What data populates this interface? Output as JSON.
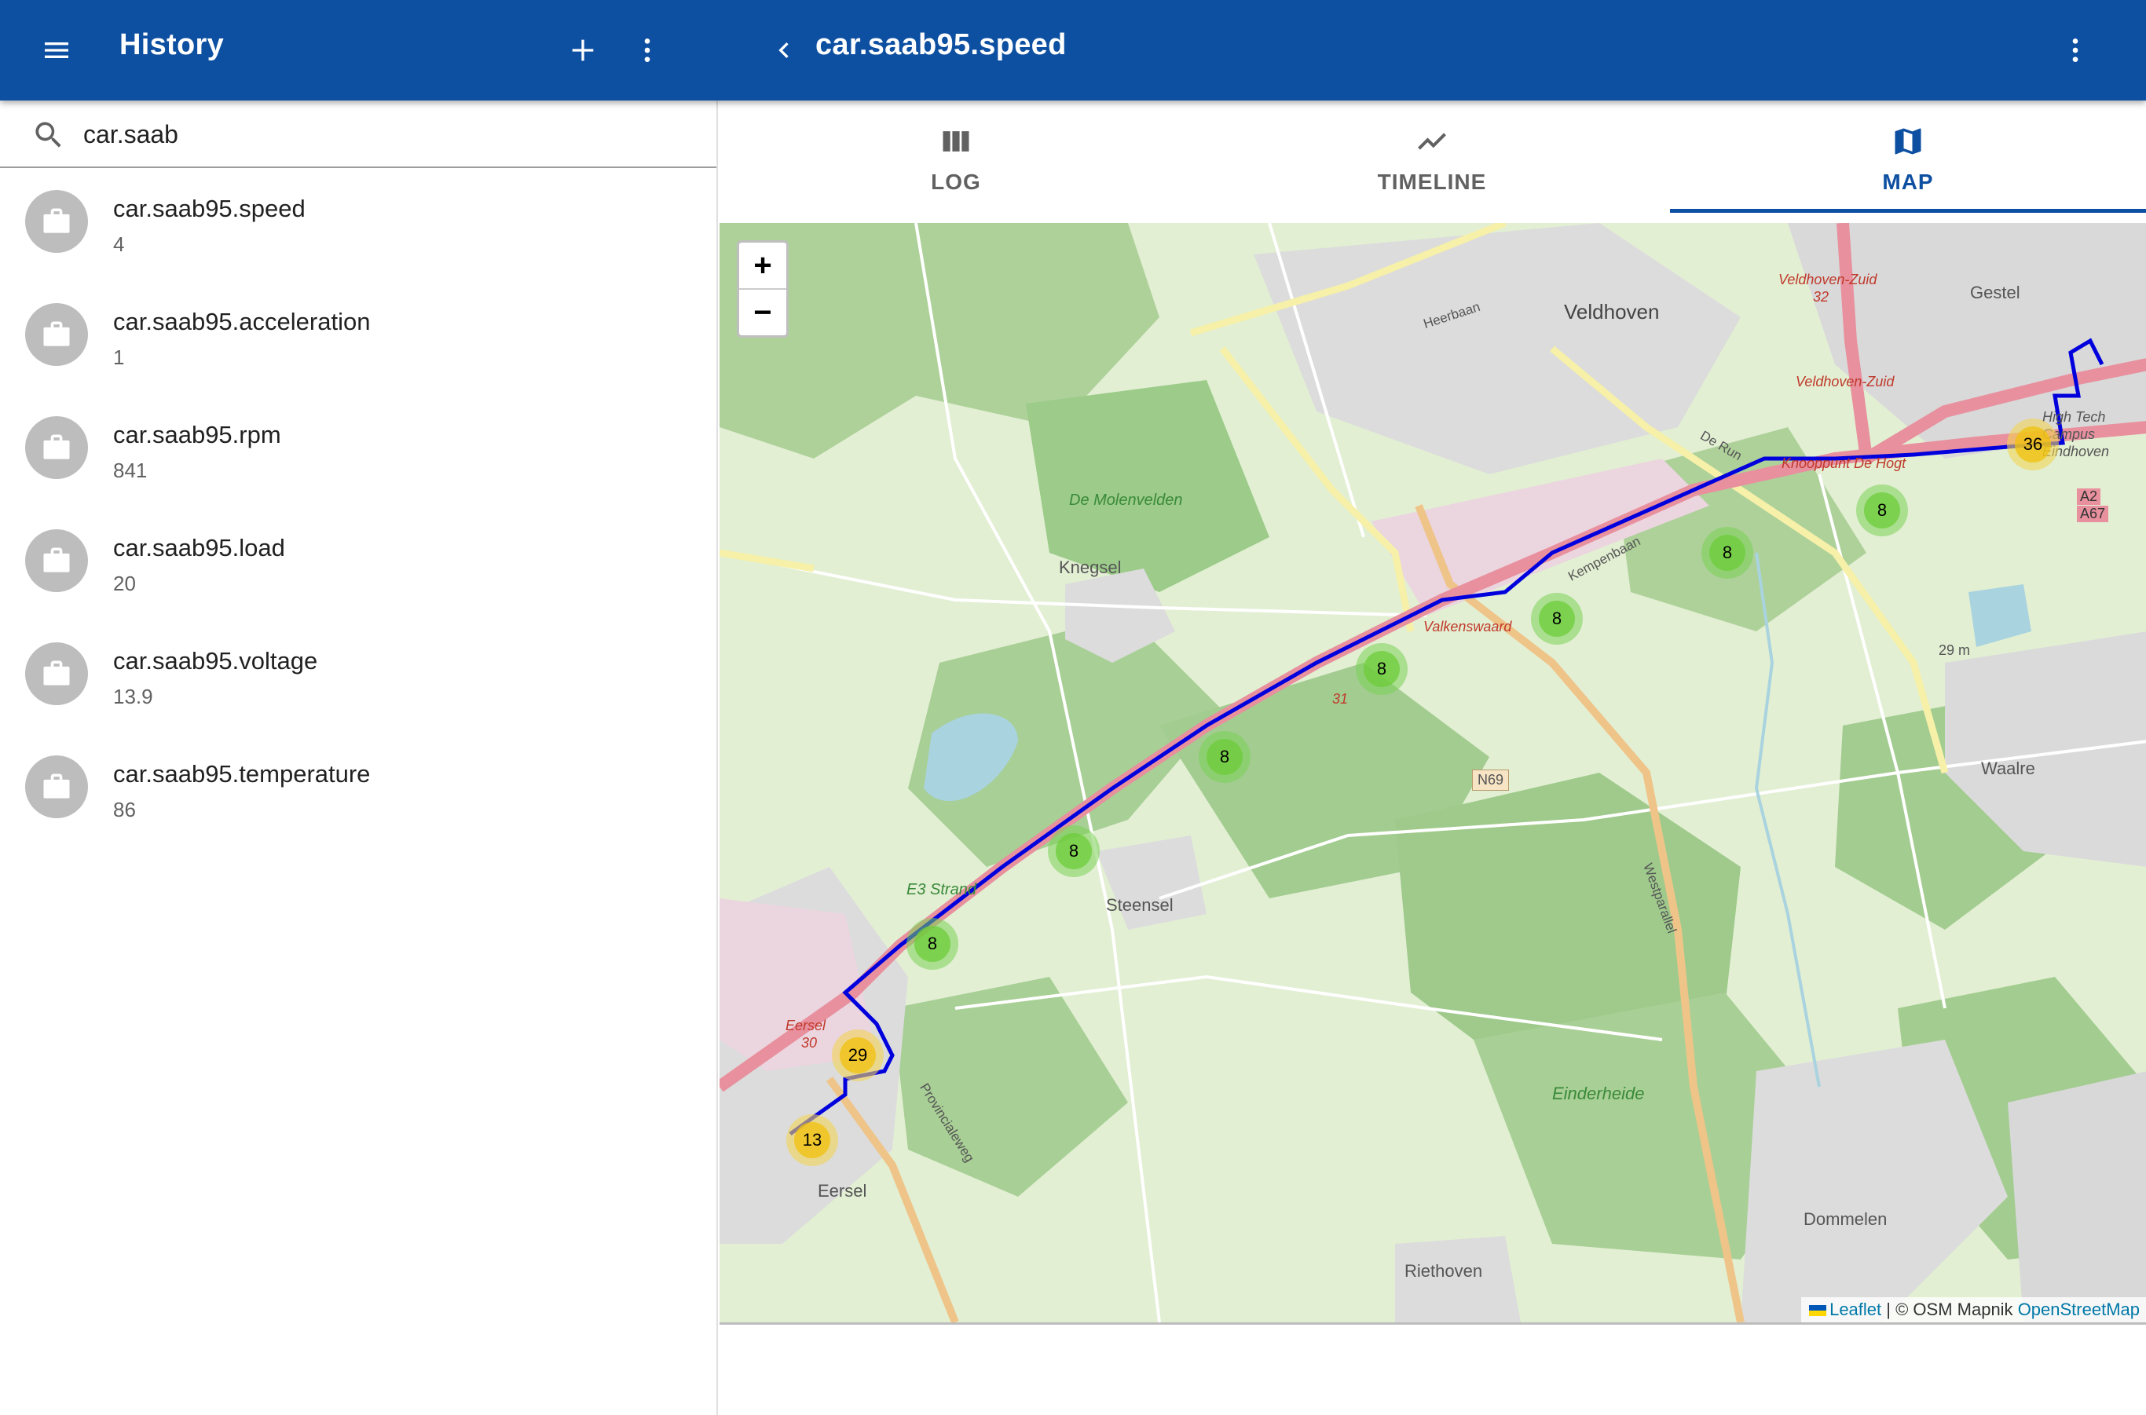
{
  "appbar": {
    "left_title": "History",
    "right_title": "car.saab95.speed",
    "colors": {
      "primary": "#0d4fa1"
    }
  },
  "search": {
    "value": "car.saab",
    "placeholder": ""
  },
  "history_items": [
    {
      "title": "car.saab95.speed",
      "subtitle": "4"
    },
    {
      "title": "car.saab95.acceleration",
      "subtitle": "1"
    },
    {
      "title": "car.saab95.rpm",
      "subtitle": "841"
    },
    {
      "title": "car.saab95.load",
      "subtitle": "20"
    },
    {
      "title": "car.saab95.voltage",
      "subtitle": "13.9"
    },
    {
      "title": "car.saab95.temperature",
      "subtitle": "86"
    }
  ],
  "tabs": [
    {
      "label": "LOG",
      "icon": "columns-icon"
    },
    {
      "label": "TIMELINE",
      "icon": "trend-icon"
    },
    {
      "label": "MAP",
      "icon": "map-icon",
      "active": true
    }
  ],
  "map": {
    "zoom_in": "+",
    "zoom_out": "−",
    "clusters": [
      "36",
      "8",
      "8",
      "8",
      "8",
      "8",
      "8",
      "8",
      "29",
      "13"
    ],
    "places": {
      "veldhoven": "Veldhoven",
      "gestel": "Gestel",
      "knegsel": "Knegsel",
      "steensel": "Steensel",
      "eersel": "Eersel",
      "waalre": "Waalre",
      "dommelen": "Dommelen",
      "riethoven": "Riethoven",
      "molenvelden": "De Molenvelden",
      "e3strand": "E3 Strand",
      "einderheide": "Einderheide",
      "knooppunt": "Knooppunt De Hogt",
      "vz1": "Veldhoven-Zuid",
      "vz2": "Veldhoven-Zuid",
      "valkenswaard": "Valkenswaard",
      "n69": "N69",
      "a2": "A2",
      "a67": "A67",
      "hightech": "High Tech Campus Eindhoven",
      "elev": "29 m",
      "eersel_exit": "Eersel",
      "exit30": "30",
      "exit31": "31",
      "exit32": "32",
      "kempenbaan": "Kempenbaan",
      "derun": "De Run",
      "heerbaan": "Heerbaan",
      "provinc": "Provincialeweg",
      "westparallel": "Westparallel"
    },
    "attribution": {
      "leaflet": "Leaflet",
      "osm": "© OSM Mapnik",
      "osm_link": "OpenStreetMap"
    }
  }
}
